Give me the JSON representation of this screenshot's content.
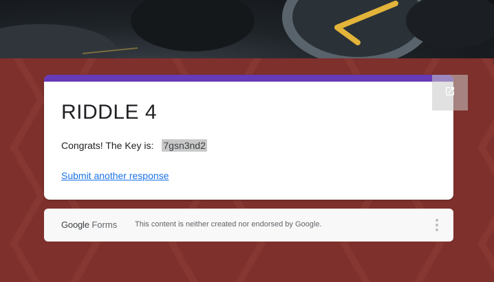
{
  "form": {
    "title": "RIDDLE 4",
    "message_prefix": "Congrats! The Key is:",
    "key_value": "7gsn3nd2",
    "submit_another_link": "Submit another response",
    "accent_color": "#673ab7"
  },
  "footer": {
    "brand_google": "Google",
    "brand_forms": "Forms",
    "disclaimer": "This content is neither created nor endorsed by Google."
  },
  "icons": {
    "popout": "open-in-new-icon",
    "more": "more-vert-icon"
  }
}
